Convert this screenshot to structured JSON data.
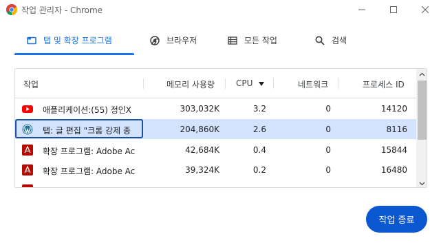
{
  "window": {
    "title": "작업 관리자 - Chrome"
  },
  "tabs": [
    {
      "label": "탭 및 확장 프로그램",
      "icon": "tab-window-icon",
      "active": true
    },
    {
      "label": "브라우저",
      "icon": "chrome-icon",
      "active": false
    },
    {
      "label": "모든 작업",
      "icon": "list-icon",
      "active": false
    },
    {
      "label": "검색",
      "icon": "search-icon",
      "active": false
    }
  ],
  "table": {
    "headers": {
      "task": "작업",
      "memory": "메모리 사용량",
      "cpu": "CPU",
      "network": "네트워크",
      "pid": "프로세스 ID"
    },
    "sort": {
      "column": "cpu",
      "direction": "descending"
    },
    "rows": [
      {
        "icon": "youtube-icon",
        "name": "애플리케이션:(55) 정인X",
        "memory": "303,032K",
        "cpu": "3.2",
        "network": "0",
        "pid": "14120",
        "selected": false
      },
      {
        "icon": "wordpress-icon",
        "name": "탭: 글 편집 \"크롬 강제 종",
        "memory": "204,860K",
        "cpu": "2.6",
        "network": "0",
        "pid": "8116",
        "selected": true
      },
      {
        "icon": "adobe-acrobat-icon",
        "name": "확장 프로그램: Adobe Ac",
        "memory": "42,684K",
        "cpu": "0.4",
        "network": "0",
        "pid": "15844",
        "selected": false
      },
      {
        "icon": "adobe-acrobat-icon",
        "name": "확장 프로그램: Adobe Ac",
        "memory": "39,324K",
        "cpu": "0.2",
        "network": "0",
        "pid": "16480",
        "selected": false
      }
    ]
  },
  "actions": {
    "end_task": "작업 종료"
  },
  "colors": {
    "accent": "#1a73e8",
    "button": "#0b57d0",
    "selected_row": "#d3e3fd",
    "youtube": "#ff0000",
    "acrobat": "#b30b00"
  }
}
